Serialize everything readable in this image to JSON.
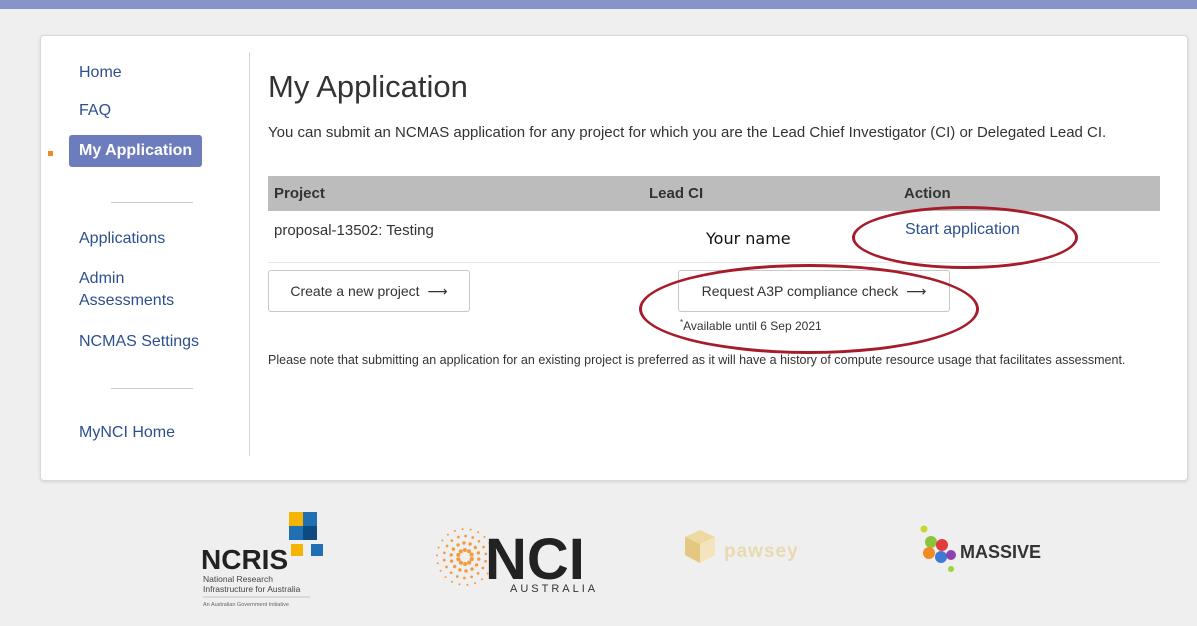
{
  "sidebar": {
    "items": [
      {
        "label": "Home"
      },
      {
        "label": "FAQ"
      },
      {
        "label": "My Application"
      },
      {
        "label": "Applications"
      },
      {
        "label": "Admin Assessments"
      },
      {
        "label": "NCMAS Settings"
      },
      {
        "label": "MyNCI Home"
      }
    ],
    "active_index": 2
  },
  "main": {
    "title": "My Application",
    "intro": "You can submit an NCMAS application for any project for which you are the Lead Chief Investigator (CI) or Delegated Lead CI.",
    "table": {
      "headers": [
        "Project",
        "Lead CI",
        "Action"
      ],
      "rows": [
        {
          "project": "proposal-13502: Testing",
          "lead_ci": "Your name",
          "action": "Start application"
        }
      ]
    },
    "create_button": "Create a new project",
    "a3p_button": "Request A3P compliance check",
    "arrow": "⟶",
    "availability_marker": "*",
    "availability": "Available until 6 Sep 2021",
    "note": "Please note that submitting an application for an existing project is preferred as it will have a history of compute resource usage that facilitates assessment."
  },
  "footer": {
    "ncris": {
      "name": "NCRIS",
      "line1": "National Research",
      "line2": "Infrastructure for Australia",
      "line3": "An Australian Government Initiative"
    },
    "nci": {
      "name": "NCI",
      "sub": "AUSTRALIA"
    },
    "pawsey": {
      "name": "pawsey"
    },
    "massive": {
      "name": "MASSIVE"
    }
  },
  "colors": {
    "topbar": "#8893c7",
    "nav_active": "#6c7cbc",
    "link": "#2c4f8f",
    "annotation": "#a61c2a",
    "ncris_blue": "#1f6fb2",
    "ncris_yellow": "#f4b400",
    "nci_orange": "#f39a3d"
  }
}
